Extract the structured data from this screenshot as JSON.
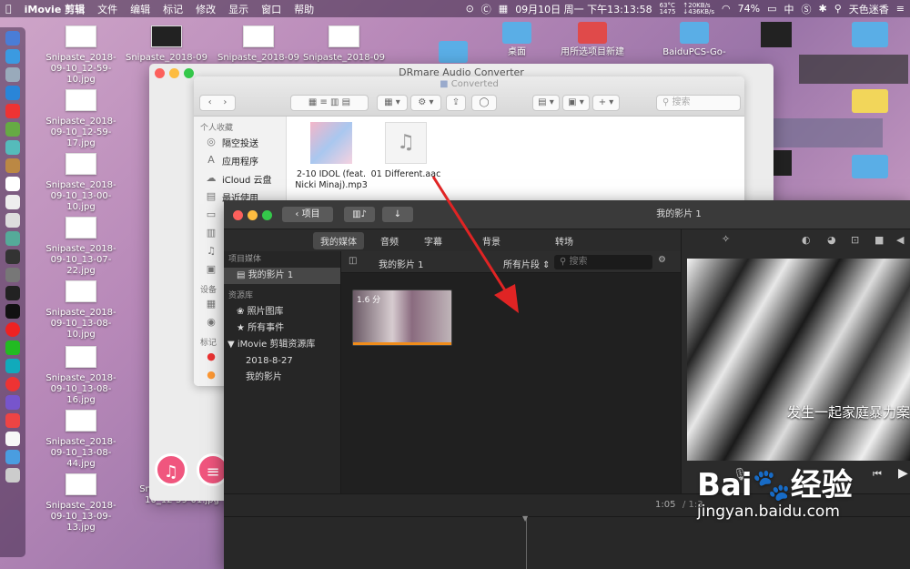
{
  "menubar": {
    "app_name": "iMovie 剪辑",
    "items": [
      "文件",
      "编辑",
      "标记",
      "修改",
      "显示",
      "窗口",
      "帮助"
    ],
    "datetime": "09月10日 周一 下午13:13:58",
    "cpu_temp": "63°C",
    "cpu_speed": "1475",
    "net_up": "↑20KB/s",
    "net_down": "↓436KB/s",
    "battery": "74%",
    "input_method": "中",
    "user": "天色迷香"
  },
  "desktop": {
    "files": [
      {
        "label": "Snipaste_2018-09-10_12-59-10.jpg"
      },
      {
        "label": "Snipaste_2018-09"
      },
      {
        "label": "Snipaste_2018-09"
      },
      {
        "label": "Snipaste_2018-09"
      },
      {
        "label": "Snipaste_2018-09-10_12-59-17.jpg"
      },
      {
        "label": "Snipaste_2018-09-10_13-00-10.jpg"
      },
      {
        "label": "Snipaste_2018-09-10_13-07-22.jpg"
      },
      {
        "label": "Snipaste_2018-09-10_13-08-10.jpg"
      },
      {
        "label": "Snipaste_2018-09-10_13-08-16.jpg"
      },
      {
        "label": "Snipaste_2018-09-10_13-08-44.jpg"
      },
      {
        "label": "Snipaste_2018-09-10_13-09-13.jpg"
      },
      {
        "label": "Snipaste_2018-09-10_12-59-01.jpg"
      },
      {
        "label": "桌面"
      },
      {
        "label": "用所选项目新建"
      },
      {
        "label": "BaiduPCS-Go-"
      }
    ]
  },
  "drmare": {
    "title": "DRmare Audio Converter"
  },
  "finder": {
    "title": "Converted",
    "search_placeholder": "搜索",
    "favorites_header": "个人收藏",
    "favorites": [
      "隔空投送",
      "应用程序",
      "iCloud 云盘",
      "最近使用"
    ],
    "devices_header": "设备",
    "tags_header": "标记",
    "files": [
      "2-10 IDOL (feat. Nicki Minaj).mp3",
      "01 Different.aac"
    ]
  },
  "imovie": {
    "back_label": "项目",
    "window_title": "我的影片 1",
    "tabs": [
      "我的媒体",
      "音频",
      "字幕",
      "背景",
      "转场"
    ],
    "sidebar": {
      "project_media_header": "项目媒体",
      "project_item": "我的影片 1",
      "library_header": "资源库",
      "library_items": [
        "照片图库",
        "所有事件"
      ],
      "imovie_library": "iMovie 剪辑资源库",
      "library_sub": [
        "2018-8-27",
        "我的影片"
      ]
    },
    "browser": {
      "title": "我的影片 1",
      "filter": "所有片段",
      "search_placeholder": "搜索",
      "clip_duration": "1.6 分"
    },
    "viewer": {
      "subtitle": "发生一起家庭暴力案"
    },
    "timecode": "1:05",
    "timecode_sep": "/ 1:3"
  },
  "watermark": {
    "brand": "Bai",
    "brand2": "经验",
    "url": "jingyan.baidu.com"
  }
}
